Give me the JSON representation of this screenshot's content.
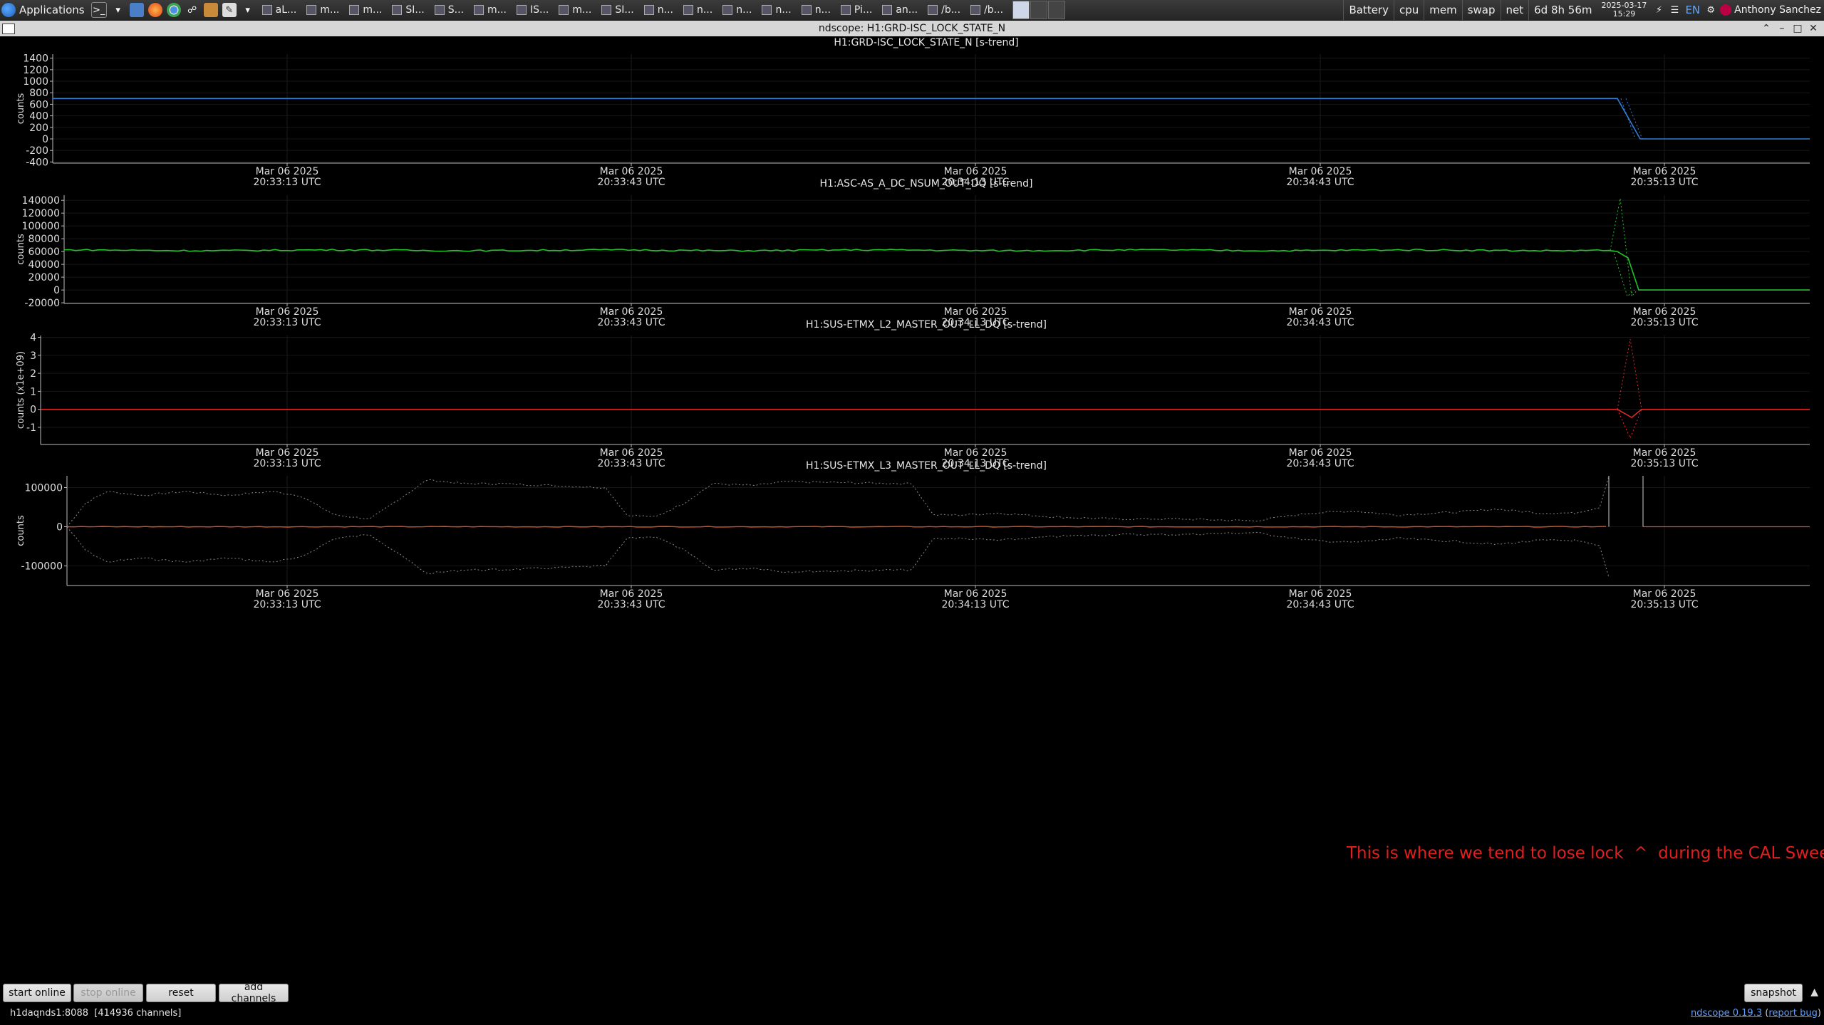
{
  "taskbar": {
    "apps_label": "Applications",
    "tasks": [
      "aL...",
      "m...",
      "m...",
      "SI...",
      "S...",
      "m...",
      "IS...",
      "m...",
      "SI...",
      "n...",
      "n...",
      "n...",
      "n...",
      "n...",
      "Pi...",
      "an...",
      "/b...",
      "/b..."
    ],
    "battery": "Battery",
    "cpu": "cpu",
    "mem": "mem",
    "swap": "swap",
    "net": "net",
    "uptime": "6d 8h 56m",
    "date": "2025-03-17",
    "time": "15:29",
    "lang": "EN",
    "user": "Anthony Sanchez"
  },
  "window": {
    "title": "ndscope: H1:GRD-ISC_LOCK_STATE_N"
  },
  "x_ticks": [
    {
      "date": "Mar 06 2025",
      "time": "20:33:13 UTC"
    },
    {
      "date": "Mar 06 2025",
      "time": "20:33:43 UTC"
    },
    {
      "date": "Mar 06 2025",
      "time": "20:34:13 UTC"
    },
    {
      "date": "Mar 06 2025",
      "time": "20:34:43 UTC"
    },
    {
      "date": "Mar 06 2025",
      "time": "20:35:13 UTC"
    }
  ],
  "plots": [
    {
      "title": "H1:GRD-ISC_LOCK_STATE_N [s-trend]",
      "ylabel": "counts",
      "color": "#2f7fd6",
      "yticks": [
        "1400",
        "1200",
        "1000",
        "800",
        "600",
        "400",
        "200",
        "0",
        "-200",
        "-400"
      ],
      "ytick_values": [
        1400,
        1200,
        1000,
        800,
        600,
        400,
        200,
        0,
        -200,
        -400
      ],
      "ylim": [
        -420,
        1470
      ],
      "kind": "step",
      "level_before": 700,
      "level_after": 0
    },
    {
      "title": "H1:ASC-AS_A_DC_NSUM_OUT_DQ [s-trend]",
      "ylabel": "counts",
      "color": "#22c22a",
      "yticks": [
        "140000",
        "120000",
        "100000",
        "80000",
        "60000",
        "40000",
        "20000",
        "0",
        "-20000"
      ],
      "ytick_values": [
        140000,
        120000,
        100000,
        80000,
        60000,
        40000,
        20000,
        0,
        -20000
      ],
      "ylim": [
        -21000,
        148000
      ],
      "kind": "nsum",
      "level_before": 62000,
      "level_after": 0,
      "spike_max": 143000,
      "spike_min": -10000
    },
    {
      "title": "H1:SUS-ETMX_L2_MASTER_OUT_LL_DQ [s-trend]",
      "ylabel": "counts (x1e+09)",
      "color": "#e02a2a",
      "yticks": [
        "4",
        "3",
        "2",
        "1",
        "0",
        "-1"
      ],
      "ytick_values": [
        4,
        3,
        2,
        1,
        0,
        -1
      ],
      "ylim": [
        -1.95,
        4.1
      ],
      "kind": "spike",
      "spike_max": 3.9,
      "spike_min": -1.6
    },
    {
      "title": "H1:SUS-ETMX_L3_MASTER_OUT_LL_DQ [s-trend]",
      "ylabel": "counts",
      "color": "#d6552a",
      "yticks": [
        "100000",
        "0",
        "-100000"
      ],
      "ytick_values": [
        100000,
        0,
        -100000
      ],
      "ylim": [
        -150000,
        130000
      ],
      "kind": "envelope"
    }
  ],
  "annotation": "This is where we tend to lose lock  ^  during the CAL Sweeps",
  "buttons": {
    "start_online": "start online",
    "stop_online": "stop online",
    "reset": "reset",
    "add_channels": "add channels",
    "snapshot": "snapshot"
  },
  "status": {
    "server": "h1daqnds1:8088",
    "channels": "[414936 channels]",
    "app_version": "ndscope 0.19.3",
    "report_bug": "report bug"
  }
}
